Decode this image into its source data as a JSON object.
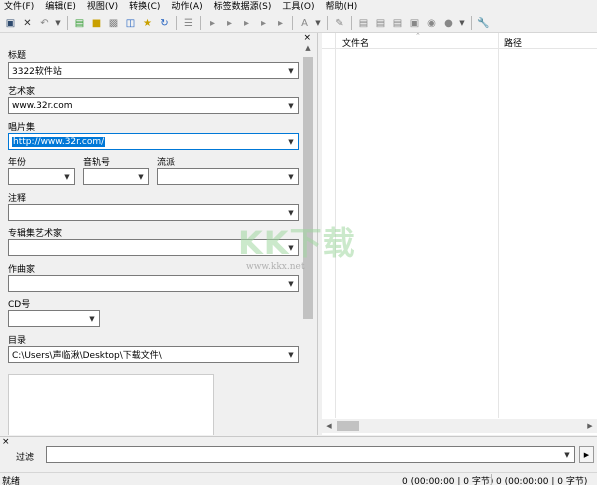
{
  "menu": [
    "文件(F)",
    "编辑(E)",
    "视图(V)",
    "转换(C)",
    "动作(A)",
    "标签数据源(S)",
    "工具(O)",
    "帮助(H)"
  ],
  "toolbar_icons": [
    "save-icon",
    "delete-icon",
    "undo-icon",
    "folder-open-icon",
    "folder-icon",
    "tag-icon",
    "export-icon",
    "favorite-star-icon",
    "refresh-icon",
    "list-icon",
    "tag-to-filename-icon",
    "filename-to-tag-icon",
    "tag-to-tag-icon",
    "text-to-tag-icon",
    "tag-to-text-icon",
    "case-conversion-icon",
    "playlist-icon",
    "html-export-icon",
    "text-file-icon",
    "keyboard-icon",
    "record-icon",
    "disc-icon",
    "wrench-icon"
  ],
  "tag_panel": {
    "close": "×",
    "title_label": "标题",
    "title_value": "3322软件站",
    "artist_label": "艺术家",
    "artist_value": "www.32r.com",
    "album_label": "唱片集",
    "album_value": "http://www.32r.com/",
    "year_label": "年份",
    "year_value": "",
    "track_label": "音轨号",
    "track_value": "",
    "genre_label": "流派",
    "genre_value": "",
    "comment_label": "注释",
    "comment_value": "",
    "album_artist_label": "专辑集艺术家",
    "album_artist_value": "",
    "composer_label": "作曲家",
    "composer_value": "",
    "disc_label": "CD号",
    "disc_value": "",
    "directory_label": "目录",
    "directory_value": "C:\\Users\\声临湫\\Desktop\\下载文件\\"
  },
  "file_list": {
    "columns": [
      "文件名",
      "路径"
    ]
  },
  "watermark": {
    "logo": "KK下载",
    "url": "www.kkx.net"
  },
  "filter": {
    "close": "×",
    "label": "过滤",
    "value": ""
  },
  "status": {
    "ready": "就绪",
    "selected": "0 (00:00:00 | 0 字节)",
    "total": "0 (00:00:00 | 0 字节)"
  },
  "colors": {
    "selection": "#0078d7",
    "background": "#f0f0f0"
  }
}
